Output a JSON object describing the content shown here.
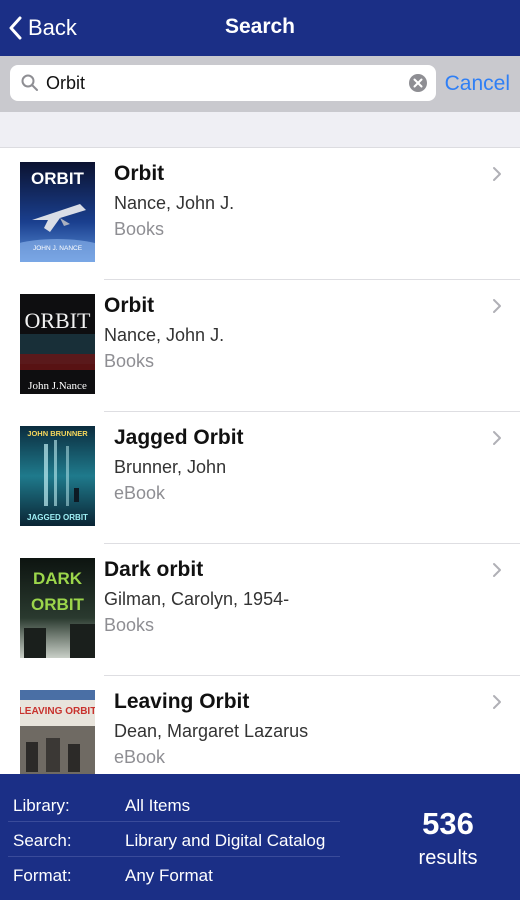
{
  "navbar": {
    "back_label": "Back",
    "title": "Search"
  },
  "search": {
    "query": "Orbit",
    "cancel_label": "Cancel"
  },
  "results": [
    {
      "title": "Orbit",
      "author": "Nance, John J.",
      "format": "Books"
    },
    {
      "title": "Orbit",
      "author": "Nance, John J.",
      "format": "Books"
    },
    {
      "title": "Jagged Orbit",
      "author": "Brunner, John",
      "format": "eBook"
    },
    {
      "title": "Dark orbit",
      "author": "Gilman, Carolyn, 1954-",
      "format": "Books"
    },
    {
      "title": "Leaving Orbit",
      "author": "Dean, Margaret Lazarus",
      "format": "eBook"
    }
  ],
  "covers": [
    {
      "big_text": "ORBIT",
      "small_text": "JOHN J. NANCE"
    },
    {
      "big_text": "ORBIT",
      "small_text": "John J.Nance"
    },
    {
      "big_text": "JOHN BRUNNER",
      "small_text": "JAGGED ORBIT"
    },
    {
      "big_text": "DARK",
      "small_text": "ORBIT"
    },
    {
      "big_text": "LEAVING ORBIT",
      "small_text": ""
    }
  ],
  "footer": {
    "library_label": "Library:",
    "library_value": "All Items",
    "search_label": "Search:",
    "search_value": "Library and Digital Catalog",
    "format_label": "Format:",
    "format_value": "Any Format",
    "count": "536",
    "count_label": "results"
  },
  "colors": {
    "bar": "#1b2f86",
    "accent": "#2f7ff5",
    "secondary_text": "#8e8e93"
  },
  "icons": {
    "back": "chevron-left-icon",
    "search": "magnifier-icon",
    "clear": "clear-circle-icon",
    "disclosure": "chevron-right-icon"
  }
}
